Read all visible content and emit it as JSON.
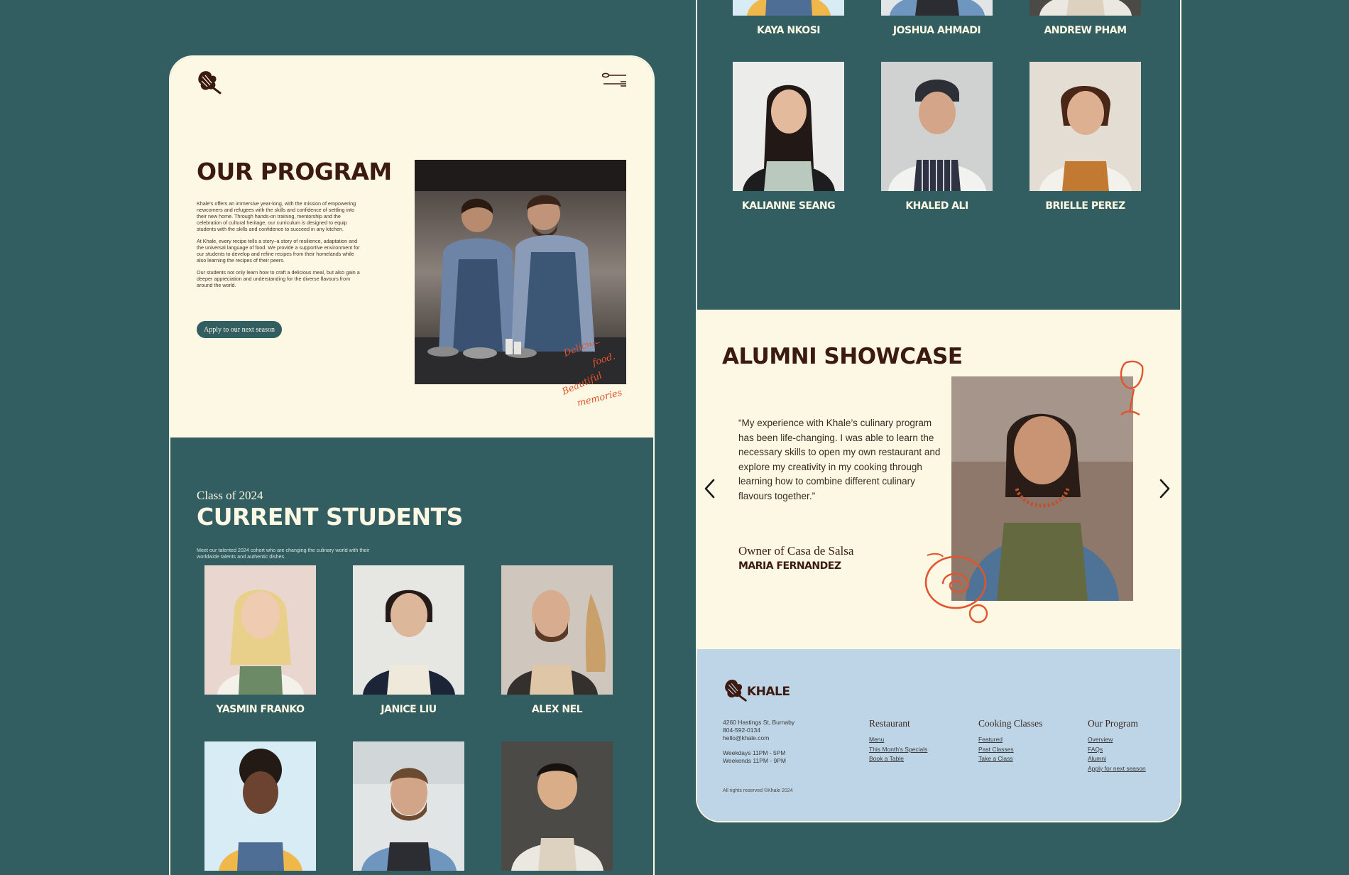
{
  "program": {
    "title": "OUR PROGRAM",
    "paragraphs": [
      "Khale's offers an immersive year-long, with the mission of empowering newcomers and refugees with the skills and confidence of settling into their new home. Through hands-on training, mentorship and the celebration of cultural heritage, our curriculum is designed to equip students with the skills and confidence to succeed in any kitchen.",
      "At Khale, every recipe tells a story–a story of resilience, adaptation and the universal language of food. We provide a supportive environment for our students to develop and refine recipes from their homelands while also learning the recipes of their peers.",
      "Our students not only learn how to craft a delicious meal, but also gain a deeper appreciation and understanding for the diverse flavours from around the world."
    ],
    "apply_label": "Apply to our next season",
    "scribble_line1": "Delicious",
    "scribble_line2": "food.",
    "scribble_line3": "Beautiful",
    "scribble_line4": "memories"
  },
  "students": {
    "class_label": "Class of 2024",
    "title": "CURRENT STUDENTS",
    "description": "Meet our talented 2024 cohort who are changing the culinary world with their worldwide talents and authentic dishes.",
    "left_names": [
      "YASMIN FRANKO",
      "JANICE LIU",
      "ALEX NEL"
    ],
    "right_names_top": [
      "KAYA NKOSI",
      "JOSHUA AHMADI",
      "ANDREW PHAM"
    ],
    "right_names_mid": [
      "KALIANNE SEANG",
      "KHALED ALI",
      "BRIELLE PEREZ"
    ]
  },
  "alumni": {
    "title": "ALUMNI SHOWCASE",
    "quote": "“My experience with Khale’s culinary program has been life-changing. I was able to learn the necessary skills to open my own restaurant and explore my creativity in my cooking through learning how to combine different culinary flavours together.”",
    "role": "Owner of Casa de Salsa",
    "name": "MARIA FERNANDEZ"
  },
  "footer": {
    "brand": "KHALE",
    "address": "4260 Hastings St, Burnaby",
    "phone": "804-592-0134",
    "email": "hello@khale.com",
    "hours_weekdays": "Weekdays 11PM - 5PM",
    "hours_weekends": "Weekends 11PM - 9PM",
    "columns": [
      {
        "heading": "Restaurant",
        "links": [
          "Menu",
          "This Month's Specials",
          "Book a Table"
        ]
      },
      {
        "heading": "Cooking Classes",
        "links": [
          "Featured",
          "Past Classes",
          "Take a Class"
        ]
      },
      {
        "heading": "Our Program",
        "links": [
          "Overview",
          "FAQs",
          "Alumni",
          "Apply for next season"
        ]
      }
    ],
    "copyright": "All rights reserved ©Khale 2024"
  },
  "colors": {
    "teal": "#335e61",
    "cream": "#fdf8e4",
    "brown": "#3d1a10",
    "accent": "#e2542c",
    "footer_blue": "#bdd5e6"
  },
  "icons": [
    "khale-logo-icon",
    "menu-utensils-icon",
    "chevron-left-icon",
    "chevron-right-icon",
    "wine-glass-doodle-icon",
    "plate-doodle-icon"
  ]
}
